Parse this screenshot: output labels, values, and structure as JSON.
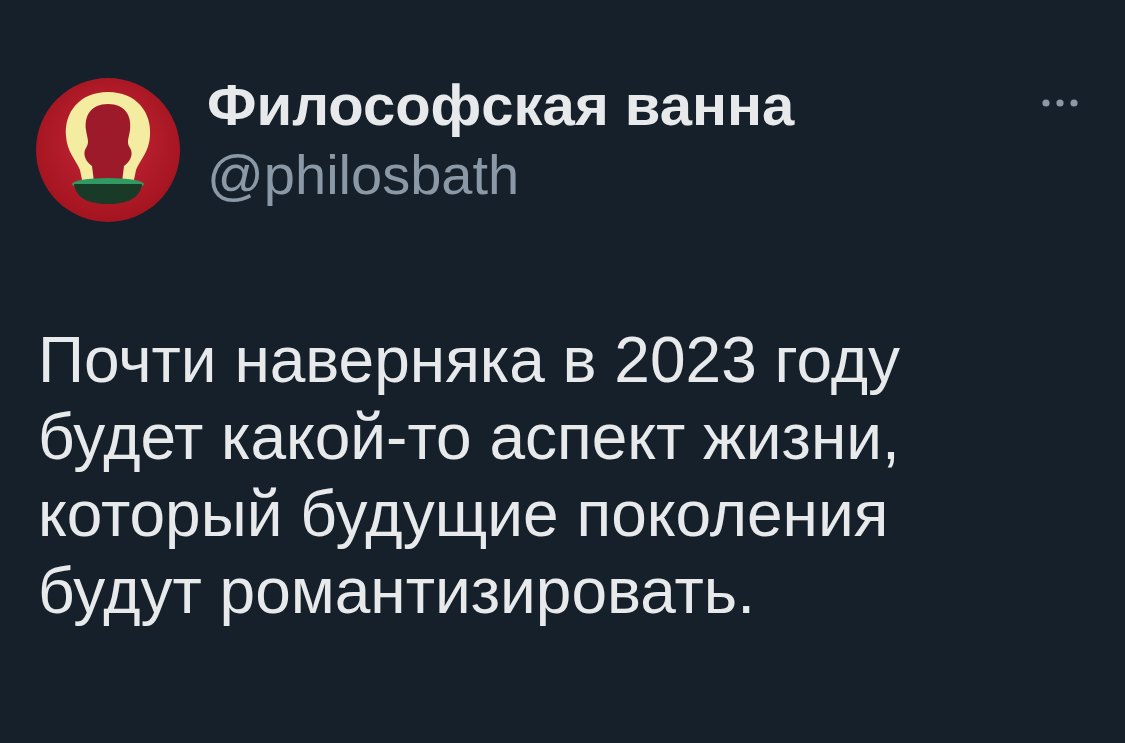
{
  "author": {
    "name": "Философская ванна",
    "handle": "@philosbath"
  },
  "tweet": {
    "text": "Почти наверняка в 2023 году будет какой-то аспект жизни, который будущие поколения будут романтизировать."
  }
}
